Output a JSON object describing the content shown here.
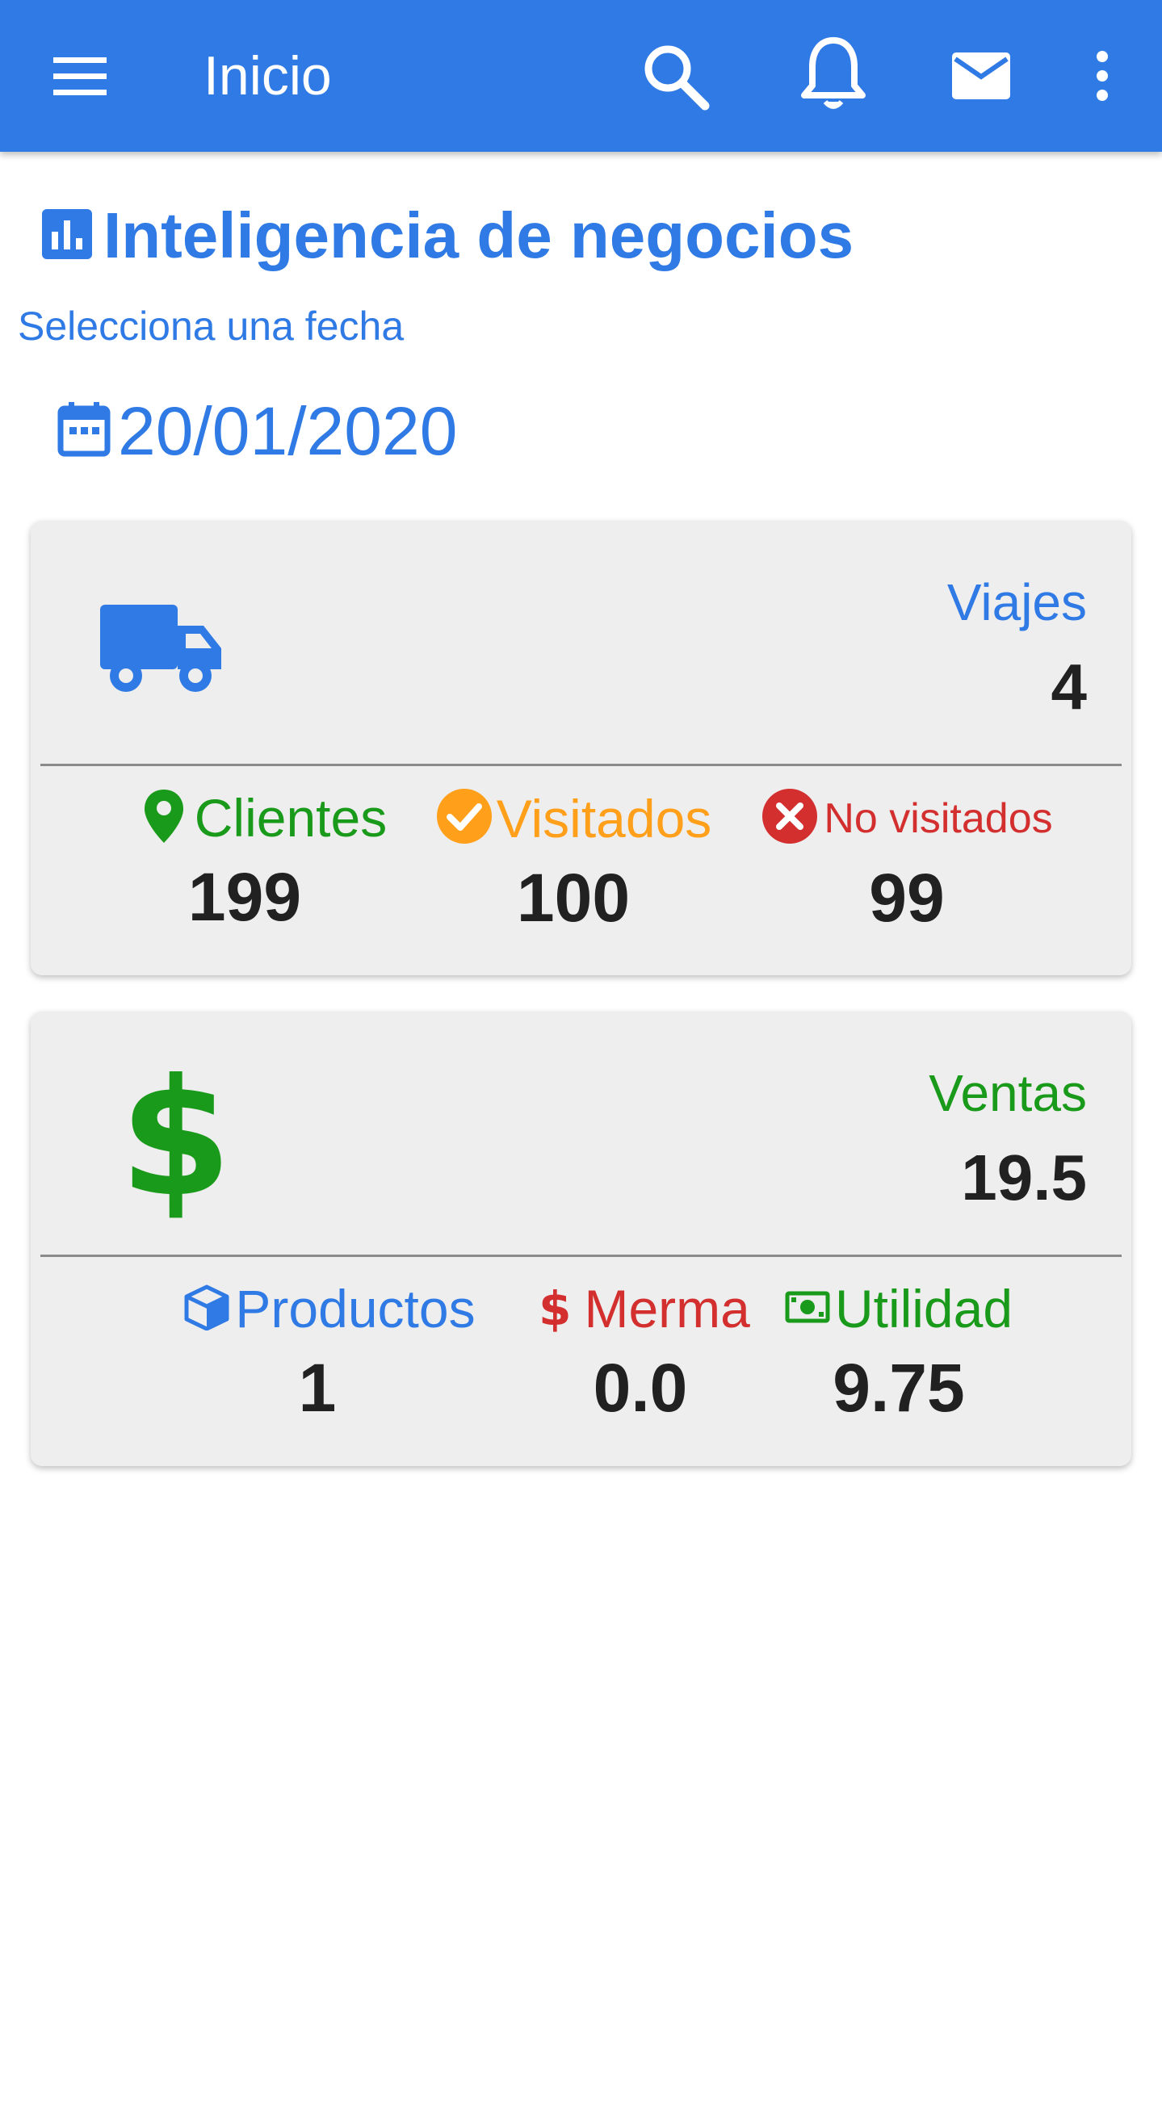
{
  "appbar": {
    "title": "Inicio",
    "icons": [
      "menu-icon",
      "search-icon",
      "bell-icon",
      "mail-icon",
      "more-vert-icon"
    ]
  },
  "section": {
    "title": "Inteligencia de negocios",
    "icon": "bar-chart-icon"
  },
  "date_picker": {
    "hint": "Selecciona una fecha",
    "value": "20/01/2020",
    "icon": "calendar-icon"
  },
  "trips_card": {
    "icon": "truck-icon",
    "label": "Viajes",
    "value": "4",
    "stats": [
      {
        "label": "Clientes",
        "value": "199",
        "icon": "location-pin-icon",
        "color": "#1a9a1a"
      },
      {
        "label": "Visitados",
        "value": "100",
        "icon": "check-circle-icon",
        "color": "#ff9f1a"
      },
      {
        "label": "No visitados",
        "value": "99",
        "icon": "cancel-circle-icon",
        "color": "#d32f2f"
      }
    ]
  },
  "sales_card": {
    "icon": "dollar-icon",
    "label": "Ventas",
    "value": "19.5",
    "stats": [
      {
        "label": "Productos",
        "value": "1",
        "icon": "cube-icon",
        "color": "#2f7ae5"
      },
      {
        "label": "Merma",
        "value": "0.0",
        "icon": "dollar-small-icon",
        "color": "#d32f2f"
      },
      {
        "label": "Utilidad",
        "value": "9.75",
        "icon": "cash-icon",
        "color": "#1a9a1a"
      }
    ]
  },
  "colors": {
    "primary": "#2f7ae5",
    "green": "#1a9a1a",
    "orange": "#ff9f1a",
    "red": "#d32f2f",
    "card_bg": "#eeeeee"
  }
}
